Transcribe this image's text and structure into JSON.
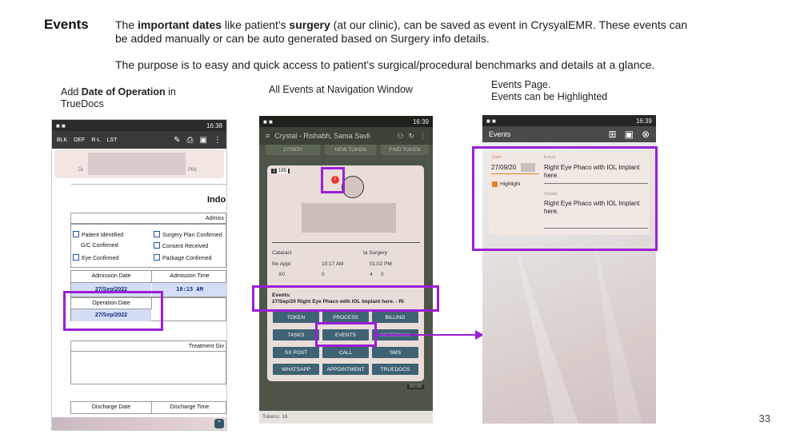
{
  "slide": {
    "heading": "Events",
    "line1_a": "The ",
    "line1_b": "important dates",
    "line1_c": " like patient's ",
    "line1_d": "surgery",
    "line1_e": " (at our clinic), can be saved as event in CrysyalEMR.  These events can",
    "line2": "be added manually or can be auto generated based on Surgery info details.",
    "line3": "The purpose is to easy and quick access to patient's surgical/procedural benchmarks and details at a glance.",
    "cap1_a": "Add ",
    "cap1_b": "Date of Operation",
    "cap1_c": " in",
    "cap1_d": "TrueDocs",
    "cap2": "All Events at Navigation Window",
    "cap3_a": "Events Page.",
    "cap3_b": "Events can be Highlighted",
    "page_number": "33"
  },
  "phone1": {
    "time": "16:38",
    "toolbar": [
      "BLK",
      "DEF",
      "R-L",
      "LST"
    ],
    "heading_partial": "Indo",
    "admiss_partial": "Admiss",
    "checks": [
      "Patient Identified",
      "Surgery Plan Confirmed",
      "G/C Confirmed",
      "Consent Received",
      "Eye Confirmed",
      "Package Confirmed"
    ],
    "admission_date_label": "Admission Date",
    "admission_time_label": "Admission Time",
    "admission_date": "27/Sep/2022",
    "admission_time": "10:15 AM",
    "operation_date_label": "Operation Date",
    "operation_date": "27/Sep/2022",
    "treatment_partial": "Treatment Giv",
    "discharge_date_label": "Discharge Date",
    "discharge_time_label": "Discharge Time",
    "card_left": "Dr",
    "card_right": "PM)"
  },
  "phone2": {
    "time": "16:39",
    "title": "Crystal - Rishabh, Sama Savli",
    "top_buttons": [
      "27/SEP/",
      "NEW TOKEN",
      "FIND TOKEN"
    ],
    "badge": "1",
    "code": "185",
    "row1": [
      "Cataract",
      "ta Surgery"
    ],
    "row2": [
      "No Appt",
      "10:17 AM",
      "01:02 PM"
    ],
    "row3": [
      "X0",
      "0",
      "4",
      "0"
    ],
    "events_label": "Events:",
    "events_text": "27/Sep/20    Right Eye Phaco with IOL Implant here. - Ri",
    "buttons": [
      "TOKEN",
      "PROCESS",
      "BILLING",
      "TASKS",
      "EVENTS",
      "MATERIALS",
      "SX POST",
      "CALL",
      "SMS",
      "WHATSAPP",
      "APPOINTMENT",
      "TRUEDOCS"
    ],
    "footer": "Tokens: 16",
    "bottom_tag": "00:00"
  },
  "phone3": {
    "time": "16:39",
    "title": "Events",
    "date_label": "Date",
    "date_value": "27/09/20",
    "event_label": "Event",
    "event_value": "Right Eye Phaco with IOL Implant here.",
    "highlight_label": "Highlight",
    "details_label": "Details",
    "details_value": "Right Eye Phaco with IOL Implant here."
  },
  "colors": {
    "highlight": "#9b1fd6",
    "button": "#3f6274"
  }
}
